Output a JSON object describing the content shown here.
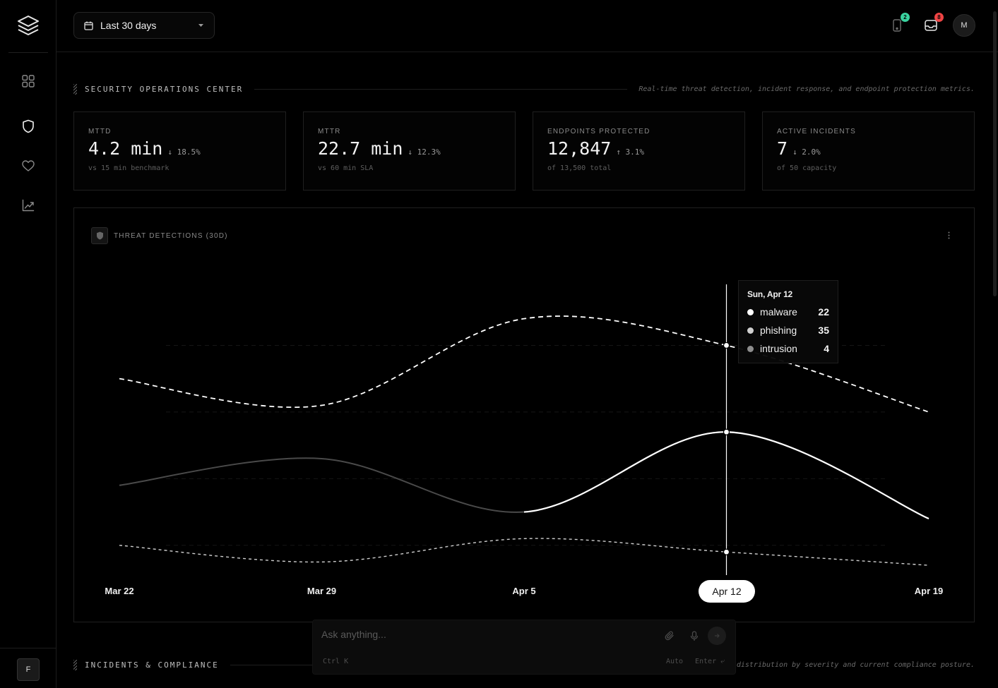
{
  "header": {
    "date_range": "Last 30 days",
    "notifications": [
      {
        "icon": "device-alert-icon",
        "count": "2",
        "color": "#3ad29f"
      },
      {
        "icon": "inbox-icon",
        "count": "8",
        "color": "#ef4444"
      }
    ],
    "avatar": "M"
  },
  "sidebar": {
    "items": [
      {
        "icon": "dashboard-grid-icon"
      },
      {
        "icon": "shield-icon"
      },
      {
        "icon": "heart-icon"
      },
      {
        "icon": "trend-chart-icon"
      }
    ],
    "org_badge": "F"
  },
  "soc": {
    "title": "SECURITY OPERATIONS CENTER",
    "description": "Real-time threat detection, incident response, and endpoint protection metrics."
  },
  "kpis": [
    {
      "label": "MTTD",
      "value": "4.2 min",
      "delta": "↓ 18.5%",
      "sub": "vs 15 min benchmark"
    },
    {
      "label": "MTTR",
      "value": "22.7 min",
      "delta": "↓ 12.3%",
      "sub": "vs 60 min SLA"
    },
    {
      "label": "ENDPOINTS PROTECTED",
      "value": "12,847",
      "delta": "↑ 3.1%",
      "sub": "of 13,500 total"
    },
    {
      "label": "ACTIVE INCIDENTS",
      "value": "7",
      "delta": "↓ 2.0%",
      "sub": "of 50 capacity"
    }
  ],
  "chart_panel": {
    "title": "THREAT DETECTIONS (30D)"
  },
  "chart_data": {
    "type": "line",
    "title": "THREAT DETECTIONS (30D)",
    "x_ticks": [
      "Mar 22",
      "Mar 29",
      "Apr 5",
      "Apr 12",
      "Apr 19"
    ],
    "ylim": [
      0,
      45
    ],
    "grid": true,
    "series": [
      {
        "name": "phishing",
        "style": "dashed",
        "color": "#ffffff",
        "points": [
          [
            "2026-03-22",
            30
          ],
          [
            "2026-03-29",
            26
          ],
          [
            "2026-04-05",
            39
          ],
          [
            "2026-04-12",
            35
          ],
          [
            "2026-04-19",
            25
          ]
        ]
      },
      {
        "name": "malware",
        "style": "solid",
        "color": "#ffffff",
        "points": [
          [
            "2026-03-22",
            14
          ],
          [
            "2026-03-29",
            18
          ],
          [
            "2026-04-05",
            10
          ],
          [
            "2026-04-12",
            22
          ],
          [
            "2026-04-19",
            9
          ]
        ]
      },
      {
        "name": "intrusion",
        "style": "dotted",
        "color": "#cfcfcf",
        "points": [
          [
            "2026-03-22",
            5
          ],
          [
            "2026-03-29",
            2.5
          ],
          [
            "2026-04-05",
            6
          ],
          [
            "2026-04-12",
            4
          ],
          [
            "2026-04-19",
            2
          ]
        ]
      }
    ],
    "highlight": {
      "x_label": "Apr  12",
      "date": "Sun, Apr 12"
    }
  },
  "tooltip": {
    "date": "Sun, Apr 12",
    "rows": [
      {
        "name": "malware",
        "value": "22",
        "color": "#ffffff"
      },
      {
        "name": "phishing",
        "value": "35",
        "color": "#d0d0d0"
      },
      {
        "name": "intrusion",
        "value": "4",
        "color": "#8e8e8e"
      }
    ]
  },
  "incidents": {
    "title": "INCIDENTS & COMPLIANCE",
    "description": "distribution by severity and current compliance posture."
  },
  "ask": {
    "placeholder": "Ask anything...",
    "shortcut": "Ctrl K",
    "mode": "Auto",
    "enter_hint": "Enter ⤶"
  }
}
